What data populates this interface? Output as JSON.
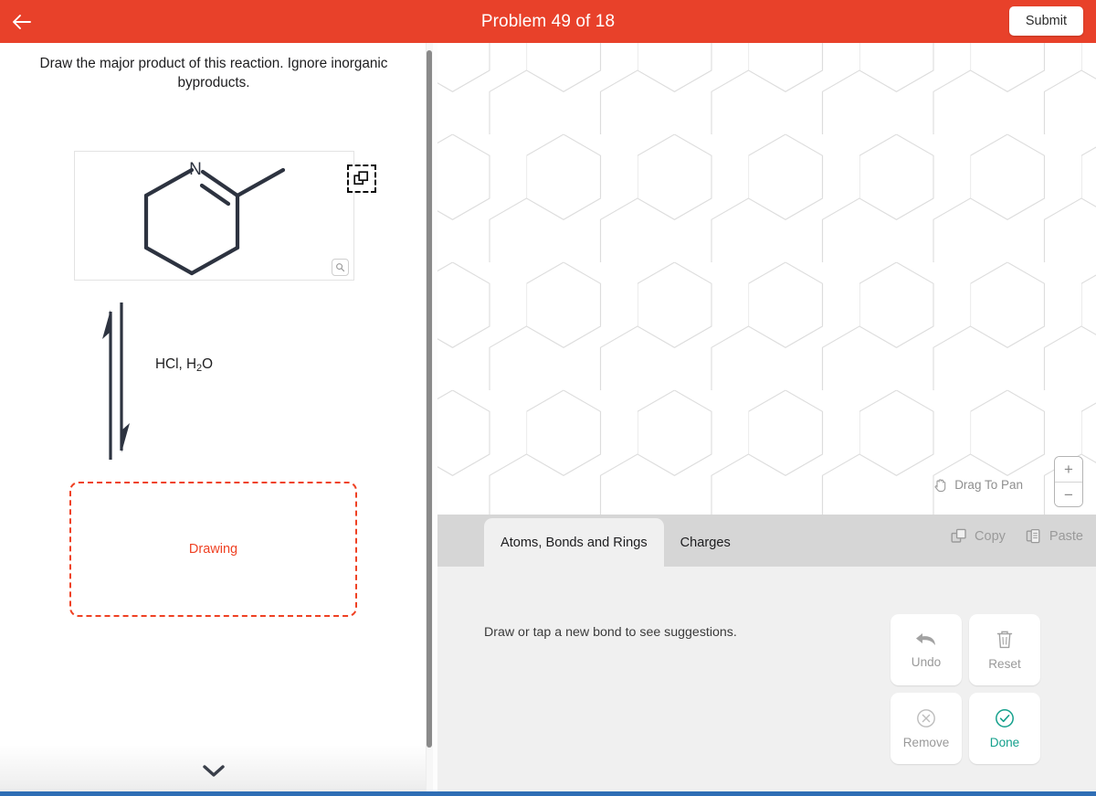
{
  "header": {
    "back_icon": "back-arrow-icon",
    "title": "Problem 49 of 18",
    "submit_label": "Submit",
    "accent_color": "#e8412a"
  },
  "left": {
    "prompt": "Draw the major product of this reaction. Ignore inorganic byproducts.",
    "molecule": {
      "atom_label": "N",
      "copy_icon": "copy-icon",
      "magnify_icon": "magnify-icon"
    },
    "reagents": "HCl, H2O",
    "reagents_parts": {
      "before": "HCl, H",
      "sub": "2",
      "after": "O"
    },
    "drawing_placeholder": "Drawing",
    "drawing_color": "#ef4123",
    "expand_icon": "chevron-down-icon"
  },
  "canvas": {
    "pan_hint": "Drag To Pan",
    "pan_icon": "hand-icon",
    "zoom_in_label": "+",
    "zoom_out_label": "−",
    "grid_color": "#dddddd"
  },
  "toolbar": {
    "tabs": [
      {
        "label": "Atoms, Bonds and Rings",
        "active": true
      },
      {
        "label": "Charges",
        "active": false
      }
    ],
    "tools": [
      {
        "label": "Copy",
        "icon": "copy-icon"
      },
      {
        "label": "Paste",
        "icon": "paste-icon"
      }
    ]
  },
  "panel": {
    "hint": "Draw or tap a new bond to see suggestions.",
    "actions": [
      {
        "label": "Undo",
        "icon": "undo-arrow-icon",
        "enabled": false
      },
      {
        "label": "Reset",
        "icon": "trash-icon",
        "enabled": false
      },
      {
        "label": "Remove",
        "icon": "remove-circle-icon",
        "enabled": false
      },
      {
        "label": "Done",
        "icon": "check-circle-icon",
        "enabled": true,
        "color": "#14a08c"
      }
    ]
  }
}
